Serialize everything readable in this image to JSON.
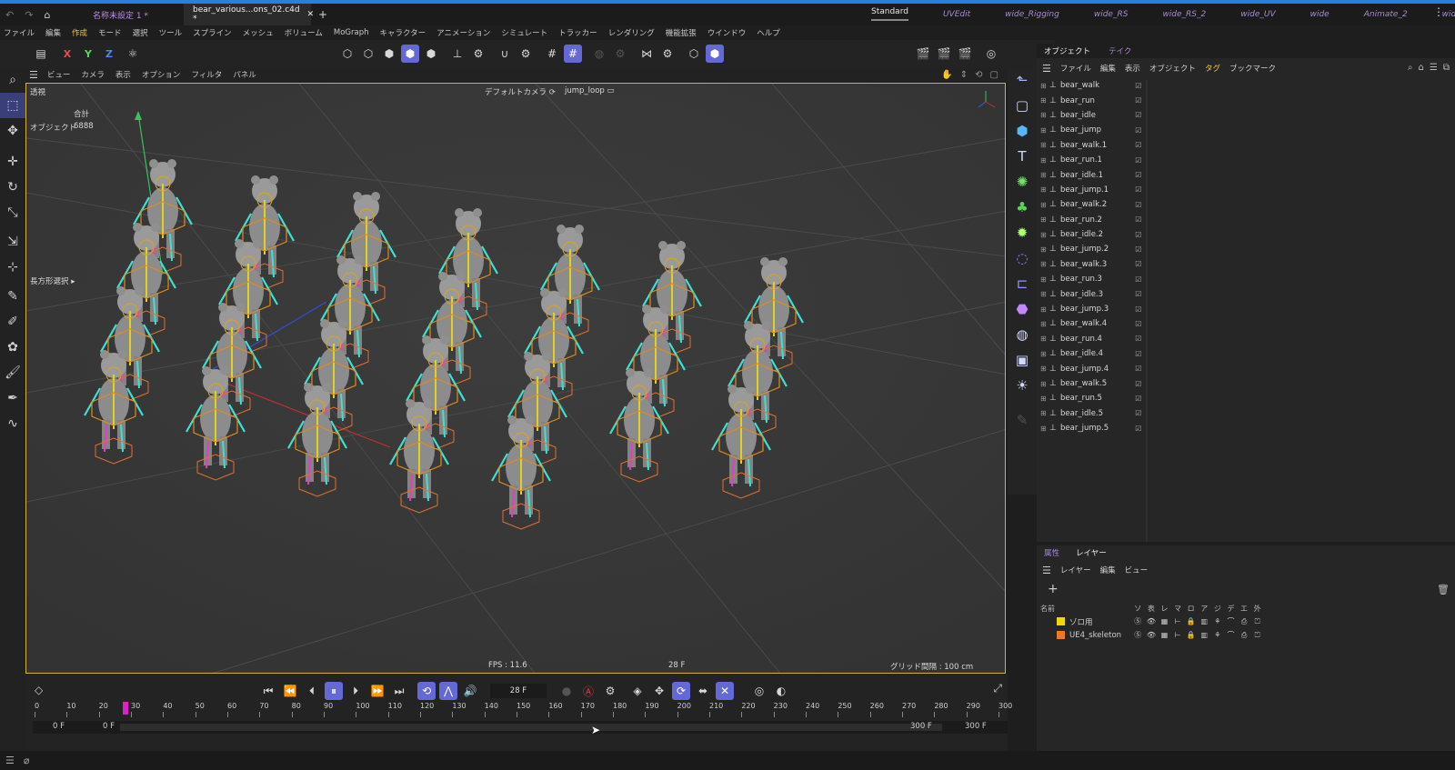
{
  "tabs": [
    {
      "label": "名称未設定 1 *",
      "active": false
    },
    {
      "label": "bear_various...ons_02.c4d *",
      "active": true
    }
  ],
  "new_tab": "+",
  "layouts": [
    "Standard",
    "UVEdit",
    "wide_Rigging",
    "wide_RS",
    "wide_RS_2",
    "wide_UV",
    "wide",
    "Animate_2",
    "wide_2"
  ],
  "menus": [
    "ファイル",
    "編集",
    "作成",
    "モード",
    "選択",
    "ツール",
    "スプライン",
    "メッシュ",
    "ボリューム",
    "MoGraph",
    "キャラクター",
    "アニメーション",
    "シミュレート",
    "トラッカー",
    "レンダリング",
    "機能拡張",
    "ウインドウ",
    "ヘルプ"
  ],
  "active_menu": "作成",
  "axis_buttons": [
    "X",
    "Y",
    "Z"
  ],
  "viewport_menu": [
    "ビュー",
    "カメラ",
    "表示",
    "オプション",
    "フィルタ",
    "パネル"
  ],
  "viewport": {
    "projection": "透視",
    "camera": "デフォルトカメラ",
    "take": "jump_loop",
    "stats_label_total": "合計",
    "stats_label_objects": "オブジェクト",
    "stats_objects": "6888",
    "selection_tool": "長方形選択",
    "fps": "FPS : 11.6",
    "frame": "28 F",
    "grid": "グリッド間隔 : 100 cm"
  },
  "object_panel": {
    "tabs": [
      "オブジェクト",
      "テイク"
    ],
    "menu": [
      "ファイル",
      "編集",
      "表示",
      "オブジェクト",
      "タグ",
      "ブックマーク"
    ],
    "objects": [
      "bear_walk",
      "bear_run",
      "bear_idle",
      "bear_jump",
      "bear_walk.1",
      "bear_run.1",
      "bear_idle.1",
      "bear_jump.1",
      "bear_walk.2",
      "bear_run.2",
      "bear_idle.2",
      "bear_jump.2",
      "bear_walk.3",
      "bear_run.3",
      "bear_idle.3",
      "bear_jump.3",
      "bear_walk.4",
      "bear_run.4",
      "bear_idle.4",
      "bear_jump.4",
      "bear_walk.5",
      "bear_run.5",
      "bear_idle.5",
      "bear_jump.5"
    ]
  },
  "attr_panel": {
    "tabs": [
      "属性",
      "レイヤー"
    ],
    "menu": [
      "レイヤー",
      "編集",
      "ビュー"
    ],
    "add": "+",
    "columns": [
      "名前",
      "ソ",
      "表",
      "レ",
      "マ",
      "ロ",
      "ア",
      "ジ",
      "デ",
      "エ",
      "外"
    ],
    "layers": [
      {
        "name": "ゾロ用",
        "color": "#f0d800"
      },
      {
        "name": "UE4_skeleton",
        "color": "#f07820"
      }
    ]
  },
  "timeline": {
    "current_frame": "28 F",
    "ticks": [
      "0",
      "10",
      "20",
      "30",
      "40",
      "50",
      "60",
      "70",
      "80",
      "90",
      "100",
      "110",
      "120",
      "130",
      "140",
      "150",
      "160",
      "170",
      "180",
      "190",
      "200",
      "210",
      "220",
      "230",
      "240",
      "250",
      "260",
      "270",
      "280",
      "290",
      "300"
    ],
    "start": "0 F",
    "start2": "0 F",
    "end": "300 F",
    "end2": "300 F",
    "playhead_frame": 28,
    "max_frame": 300
  },
  "colors": {
    "accent": "#6469d6",
    "highlight": "#d6b03a",
    "playhead": "#e020c0",
    "selection_blue": "#2a80d8"
  }
}
